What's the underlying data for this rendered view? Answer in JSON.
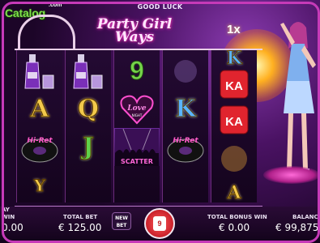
{
  "watermark": {
    "brand": "Catalog",
    "suffix": ".com"
  },
  "header": {
    "status_text": "GOOD LUCK"
  },
  "game": {
    "title_line1": "Party Girl",
    "title_line2": "Ways",
    "multiplier": "1x"
  },
  "reels": [
    {
      "symbols": [
        "vodka-bottle",
        "A",
        "Hi-Ret",
        "Y"
      ]
    },
    {
      "symbols": [
        "vodka-bottle",
        "Q",
        "J",
        ""
      ]
    },
    {
      "symbols": [
        "9",
        "Love",
        "Scatter",
        ""
      ]
    },
    {
      "symbols": [
        "wild-partial",
        "K",
        "Hi-Ret",
        ""
      ]
    },
    {
      "symbols": [
        "K",
        "dice",
        "dice",
        "A"
      ]
    }
  ],
  "symbol_texts": {
    "love": "Love",
    "love_sub": "NIGHT",
    "scatter": "SCATTER",
    "disc": "Hi-Ret",
    "dice": "KA"
  },
  "bottom": {
    "left_label": "AY",
    "left_label2": "WIN",
    "left_value": "0.00",
    "total_bet_label": "TOTAL BET",
    "total_bet_value": "€ 125.00",
    "new_bet_line1": "NEW",
    "new_bet_line2": "BET",
    "spin_value": "9",
    "total_bonus_win_label": "TOTAL BONUS WIN",
    "total_bonus_win_value": "€ 0.00",
    "balance_label": "BALANCE",
    "balance_value": "€ 99,875"
  },
  "colors": {
    "border": "#c63ab8",
    "spin": "#c9202a",
    "accent_gold": "#f3c94b"
  }
}
